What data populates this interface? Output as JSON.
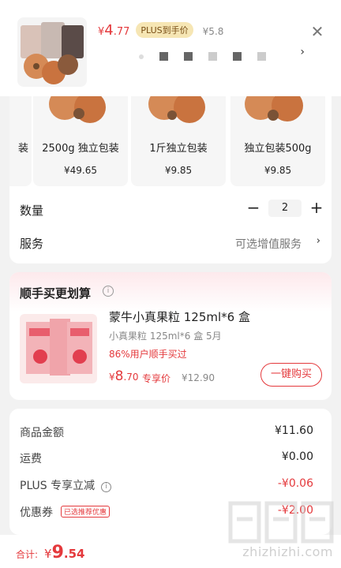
{
  "header": {
    "price_yen": "¥",
    "price_int": "4",
    "price_dec": ".77",
    "plus_badge": "PLUS到手价",
    "orig_price": "¥5.8",
    "close_icon": "close-icon"
  },
  "variants": [
    {
      "label": "装",
      "price": ""
    },
    {
      "label": "2500g 独立包装",
      "price": "¥49.65"
    },
    {
      "label": "1斤独立包装",
      "price": "¥9.85"
    },
    {
      "label": "独立包装500g",
      "price": "¥9.85"
    }
  ],
  "quantity": {
    "label": "数量",
    "value": "2",
    "minus": "−",
    "plus": "+"
  },
  "service": {
    "label": "服务",
    "value": "可选增值服务",
    "chevron": "›"
  },
  "crosssell": {
    "title": "顺手买更划算",
    "info": "i",
    "name": "蒙牛小真果粒 125ml*6 盒",
    "sub": "小真果粒 125ml*6 盒 5月",
    "percent": "86%用户顺手买过",
    "price_yen": "¥",
    "price_int": "8",
    "price_dec": ".70",
    "tag": "专享价",
    "orig_price": "¥12.90",
    "buy_button": "一键购买"
  },
  "summary": {
    "rows": [
      {
        "label": "商品金额",
        "value": "¥11.60"
      },
      {
        "label": "运费",
        "value": "¥0.00"
      },
      {
        "label": "PLUS 专享立减",
        "value": "-¥0.06"
      },
      {
        "label": "优惠券",
        "tag": "已选推荐优惠",
        "value": "-¥2.00"
      }
    ]
  },
  "footer": {
    "total_label": "合计:",
    "total_yen": "¥",
    "total_int": "9",
    "total_dec": ".54"
  },
  "watermark": {
    "text": "zhizhizhi.com"
  },
  "colors": {
    "accent": "#e4393c",
    "plus_badge_bg": "#f6e6b4"
  }
}
